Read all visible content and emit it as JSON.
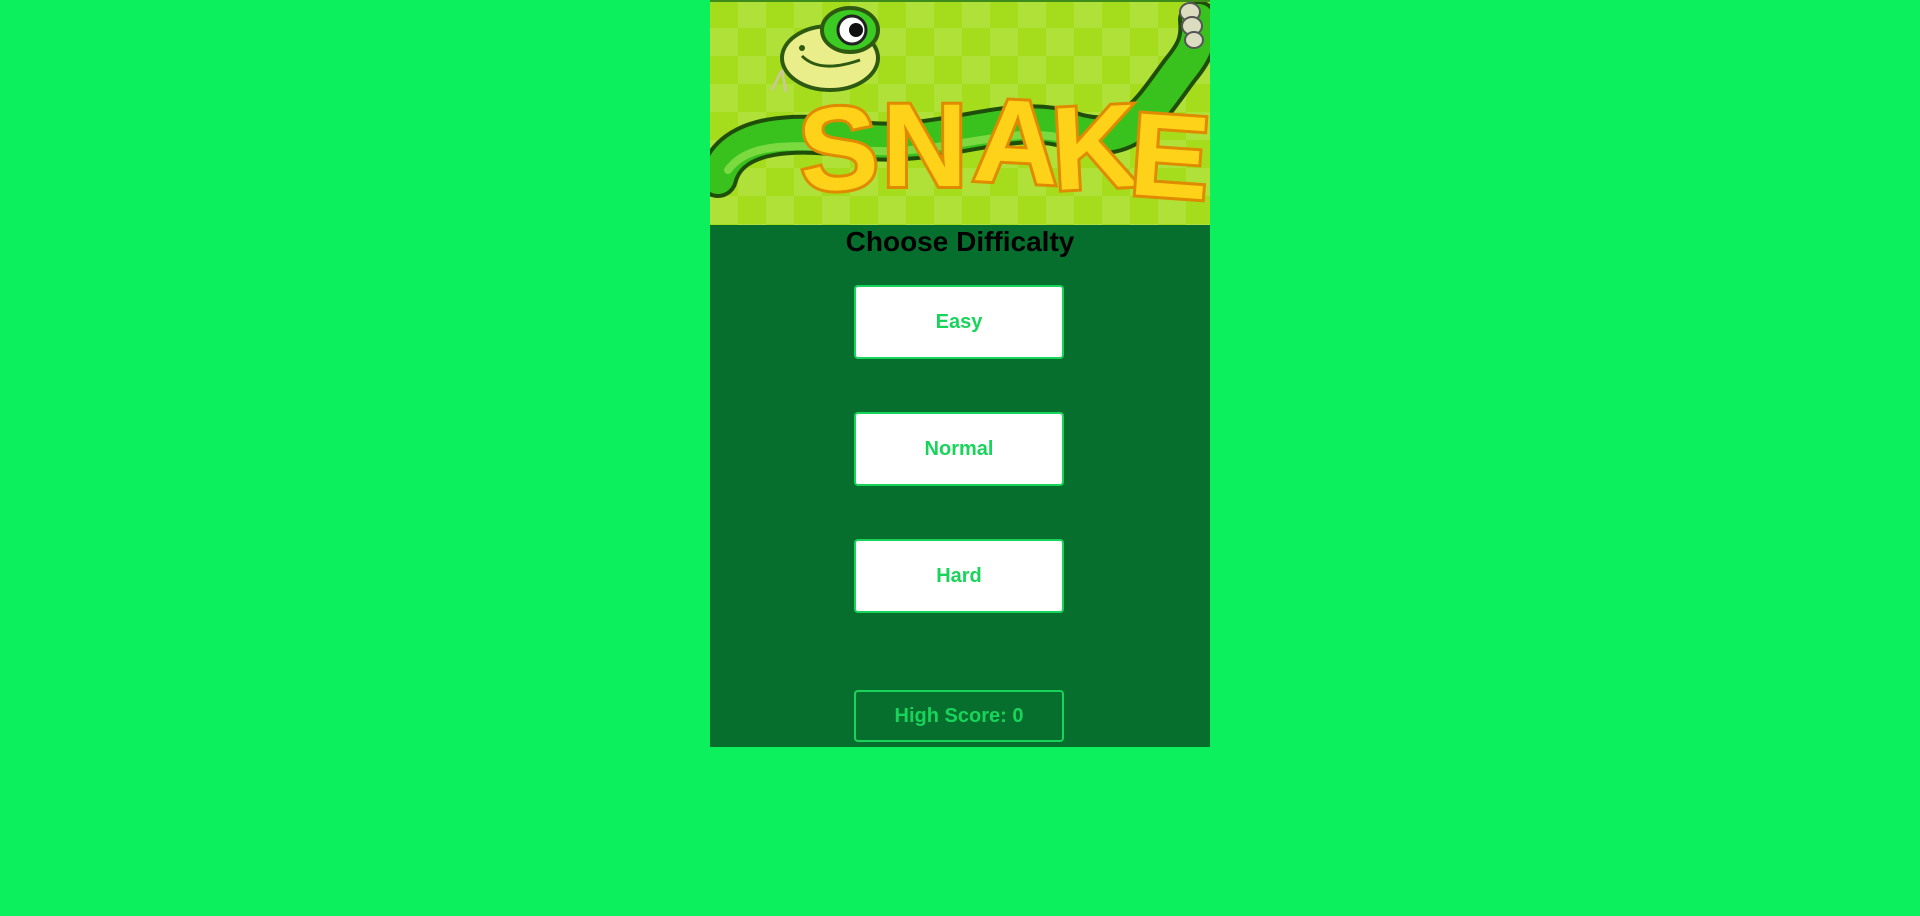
{
  "banner": {
    "logo_text": "SNAKE",
    "icon": "snake-logo-icon"
  },
  "menu": {
    "title": "Choose Difficalty",
    "difficulties": [
      {
        "label": "Easy"
      },
      {
        "label": "Normal"
      },
      {
        "label": "Hard"
      }
    ]
  },
  "high_score": {
    "label": "High Score: 0"
  },
  "colors": {
    "page_background": "#0df05e",
    "panel_background": "#066f2e",
    "button_text": "#19d45a",
    "button_background": "#ffffff",
    "logo_fill": "#ffd21a",
    "logo_outline": "#e08a00"
  }
}
